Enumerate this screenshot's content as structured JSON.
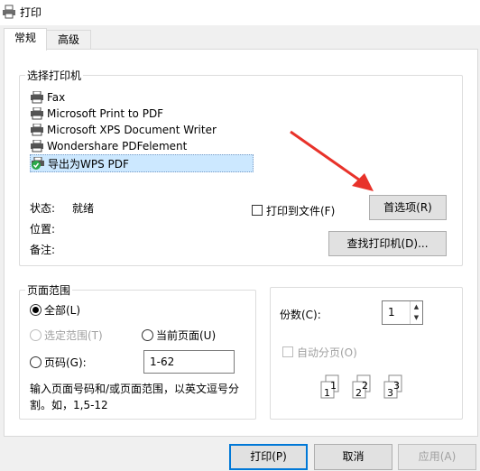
{
  "window": {
    "title": "打印"
  },
  "tabs": [
    {
      "label": "常规"
    },
    {
      "label": "高级"
    }
  ],
  "select_printer": {
    "legend": "选择打印机",
    "printers": [
      {
        "name": "Fax",
        "icon": "printer-icon"
      },
      {
        "name": "Microsoft Print to PDF",
        "icon": "printer-icon"
      },
      {
        "name": "Microsoft XPS Document Writer",
        "icon": "printer-icon"
      },
      {
        "name": "Wondershare PDFelement",
        "icon": "printer-icon"
      },
      {
        "name": "导出为WPS PDF",
        "icon": "default-printer-check-icon",
        "selected": true
      }
    ],
    "status_label": "状态:",
    "status_value": "就绪",
    "location_label": "位置:",
    "comment_label": "备注:",
    "print_to_file_label": "打印到文件(F)",
    "print_to_file_checked": false,
    "preferences_button": "首选项(R)",
    "find_printer_button": "查找打印机(D)..."
  },
  "page_range": {
    "legend": "页面范围",
    "all_label": "全部(L)",
    "selection_label": "选定范围(T)",
    "current_page_label": "当前页面(U)",
    "pages_label": "页码(G):",
    "pages_value": "1-62",
    "selected_option": "all",
    "hint": "输入页面号码和/或页面范围，以英文逗号分割。如，1,5-12"
  },
  "copies": {
    "label": "份数(C):",
    "value": "1",
    "collate_label": "自动分页(O)",
    "collate_enabled": false
  },
  "footer": {
    "print_button": "打印(P)",
    "cancel_button": "取消",
    "apply_button": "应用(A)"
  },
  "annotation": {
    "arrow_color": "#e8322a"
  }
}
